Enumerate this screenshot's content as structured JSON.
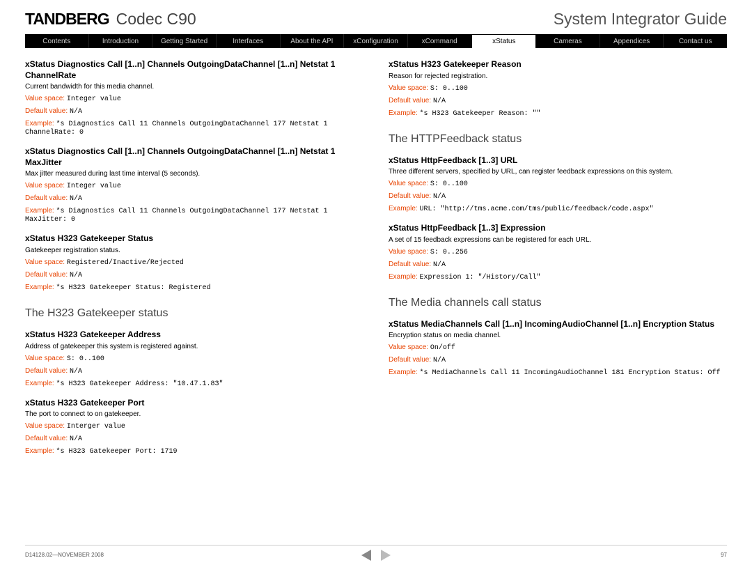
{
  "header": {
    "brand": "TANDBERG",
    "product": "Codec C90",
    "guide": "System Integrator Guide"
  },
  "nav": {
    "items": [
      {
        "label": "Contents",
        "active": false
      },
      {
        "label": "Introduction",
        "active": false
      },
      {
        "label": "Getting Started",
        "active": false
      },
      {
        "label": "Interfaces",
        "active": false
      },
      {
        "label": "About the API",
        "active": false
      },
      {
        "label": "xConfiguration",
        "active": false
      },
      {
        "label": "xCommand",
        "active": false
      },
      {
        "label": "xStatus",
        "active": true
      },
      {
        "label": "Cameras",
        "active": false
      },
      {
        "label": "Appendices",
        "active": false
      },
      {
        "label": "Contact us",
        "active": false
      }
    ]
  },
  "labels": {
    "value_space": "Value space:",
    "default_value": "Default value:",
    "example": "Example:"
  },
  "left": {
    "blocks": [
      {
        "title": "xStatus Diagnostics Call [1..n] Channels OutgoingDataChannel [1..n] Netstat 1 ChannelRate",
        "desc": "Current bandwidth for this media channel.",
        "value_space": "Integer value",
        "default_value": "N/A",
        "example": "*s Diagnostics Call 11 Channels OutgoingDataChannel 177 Netstat 1 ChannelRate: 0"
      },
      {
        "title": "xStatus Diagnostics Call [1..n] Channels OutgoingDataChannel [1..n] Netstat 1 MaxJitter",
        "desc": "Max jitter measured during last time interval (5 seconds).",
        "value_space": "Integer value",
        "default_value": "N/A",
        "example": "*s Diagnostics Call 11 Channels OutgoingDataChannel 177 Netstat 1 MaxJitter: 0"
      },
      {
        "title": "xStatus H323 Gatekeeper Status",
        "desc": "Gatekeeper registration status.",
        "value_space": "Registered/Inactive/Rejected",
        "default_value": "N/A",
        "example": "*s H323 Gatekeeper Status: Registered"
      }
    ],
    "section": "The H323 Gatekeeper status",
    "blocks2": [
      {
        "title": "xStatus H323 Gatekeeper Address",
        "desc": "Address of gatekeeper this system is registered against.",
        "value_space": "S: 0..100",
        "default_value": "N/A",
        "example": "*s H323 Gatekeeper Address: \"10.47.1.83\""
      },
      {
        "title": "xStatus H323 Gatekeeper Port",
        "desc": "The port to connect to on gatekeeper.",
        "value_space": "Interger value",
        "default_value": "N/A",
        "example": "*s H323 Gatekeeper Port: 1719"
      }
    ]
  },
  "right": {
    "blocks0": [
      {
        "title": "xStatus H323 Gatekeeper Reason",
        "desc": "Reason for rejected registration.",
        "value_space": "S: 0..100",
        "default_value": "N/A",
        "example": "*s H323 Gatekeeper Reason: \"\""
      }
    ],
    "section1": "The HTTPFeedback status",
    "blocks1": [
      {
        "title": "xStatus HttpFeedback [1..3] URL",
        "desc": "Three different servers, specified by URL, can register feedback expressions on this system.",
        "value_space": "S: 0..100",
        "default_value": "N/A",
        "example": "URL: \"http://tms.acme.com/tms/public/feedback/code.aspx\""
      },
      {
        "title": "xStatus HttpFeedback [1..3] Expression",
        "desc": "A set of 15 feedback expressions can be registered for each URL.",
        "value_space": "S: 0..256",
        "default_value": "N/A",
        "example": "Expression 1: \"/History/Call\""
      }
    ],
    "section2": "The Media channels call status",
    "blocks2": [
      {
        "title": "xStatus MediaChannels Call [1..n] IncomingAudioChannel [1..n] Encryption Status",
        "desc": "Encryption status on media channel.",
        "value_space": "On/off",
        "default_value": "N/A",
        "example": "*s MediaChannels Call 11 IncomingAudioChannel 181 Encryption Status: Off"
      }
    ]
  },
  "footer": {
    "doc": "D14128.02—NOVEMBER 2008",
    "page": "97"
  }
}
